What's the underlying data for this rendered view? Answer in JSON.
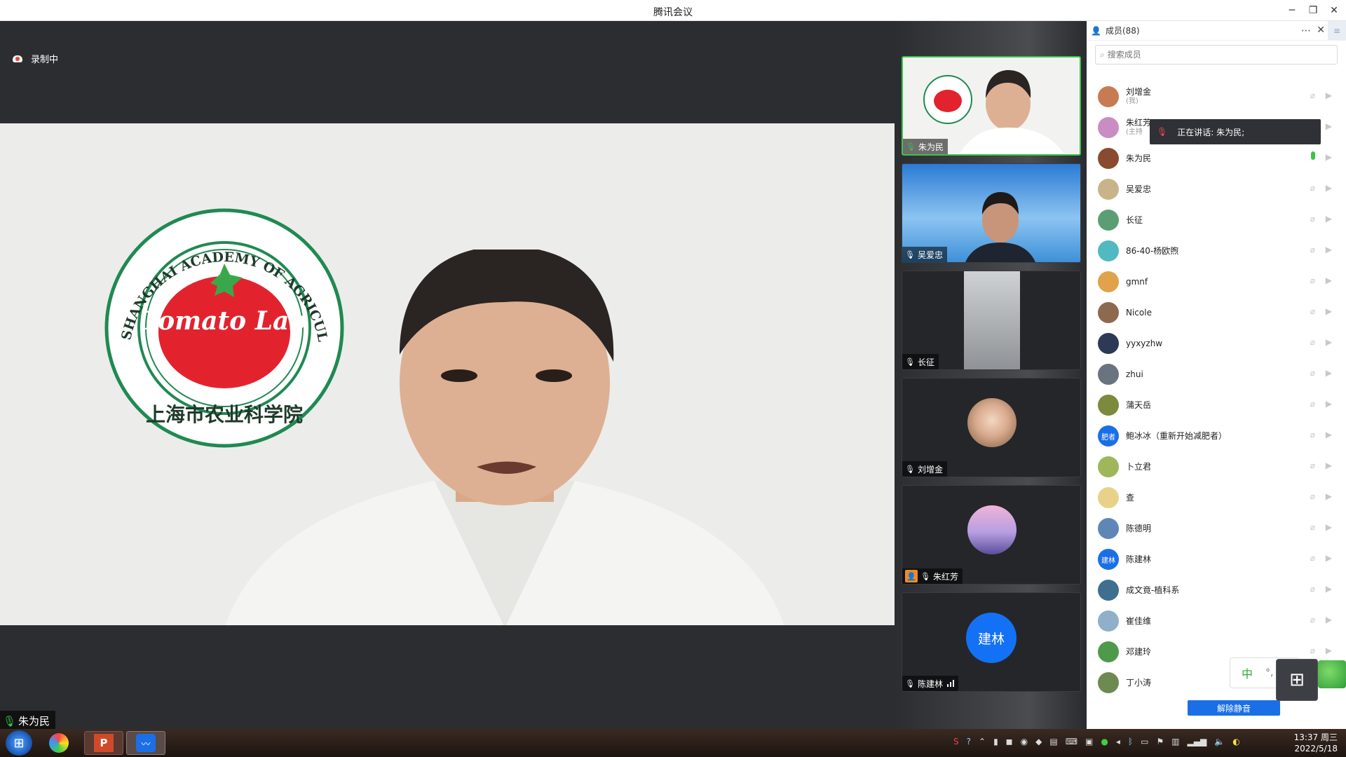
{
  "window": {
    "title": "腾讯会议"
  },
  "recording": {
    "label": "录制中"
  },
  "main_speaker": {
    "name": "朱为民"
  },
  "logo": {
    "text": "Tomato Lab",
    "ring_text": "SHANGHAI ACADEMY OF AGRICULTURAL SCIENCES",
    "seal_text": "上海市农业科学院"
  },
  "gallery": [
    {
      "name": "朱为民",
      "active": true
    },
    {
      "name": "吴爱忠"
    },
    {
      "name": "长征"
    },
    {
      "name": "刘增金"
    },
    {
      "name": "朱红芳"
    },
    {
      "name": "陈建林",
      "initials": "建林"
    }
  ],
  "panel": {
    "header": "成员(88)",
    "search_placeholder": "搜索成员",
    "tooltip": "正在讲话: 朱为民;",
    "unmute_label": "解除静音",
    "members": [
      {
        "name": "刘增金",
        "sub": "(我)",
        "color": "#c77b52"
      },
      {
        "name": "朱红芳",
        "sub": "(主持",
        "color": "#c98cc3"
      },
      {
        "name": "朱为民",
        "color": "#8a4a2f",
        "speaking": true
      },
      {
        "name": "吴爱忠",
        "color": "#c9b48a"
      },
      {
        "name": "长征",
        "color": "#5c9e74"
      },
      {
        "name": "86-40-杨欧煦",
        "color": "#51b9c2"
      },
      {
        "name": "gmnf",
        "color": "#e0a24a"
      },
      {
        "name": "Nicole",
        "color": "#8d6a4f"
      },
      {
        "name": "yyxyzhw",
        "color": "#2d3a55"
      },
      {
        "name": "zhui",
        "color": "#6a7480"
      },
      {
        "name": "蒲天岳",
        "color": "#7b8a3c"
      },
      {
        "name": "鲍冰冰（重新开始减肥者）",
        "color": "#1b6fe6",
        "initials": "肥者"
      },
      {
        "name": "卜立君",
        "color": "#9fb65a"
      },
      {
        "name": "查",
        "color": "#e8d28a"
      },
      {
        "name": "陈德明",
        "color": "#5e87b8"
      },
      {
        "name": "陈建林",
        "color": "#1b6fe6",
        "initials": "建林"
      },
      {
        "name": "成文竟-植科系",
        "color": "#3e6f8f"
      },
      {
        "name": "崔佳维",
        "color": "#8fb0c8"
      },
      {
        "name": "邓建玲",
        "color": "#4f9a4a"
      },
      {
        "name": "丁小涛",
        "color": "#6d8a52"
      }
    ]
  },
  "ime": {
    "mode": "中",
    "punct": "°,"
  },
  "taskbar": {
    "time": "13:37 周三",
    "date": "2022/5/18"
  }
}
